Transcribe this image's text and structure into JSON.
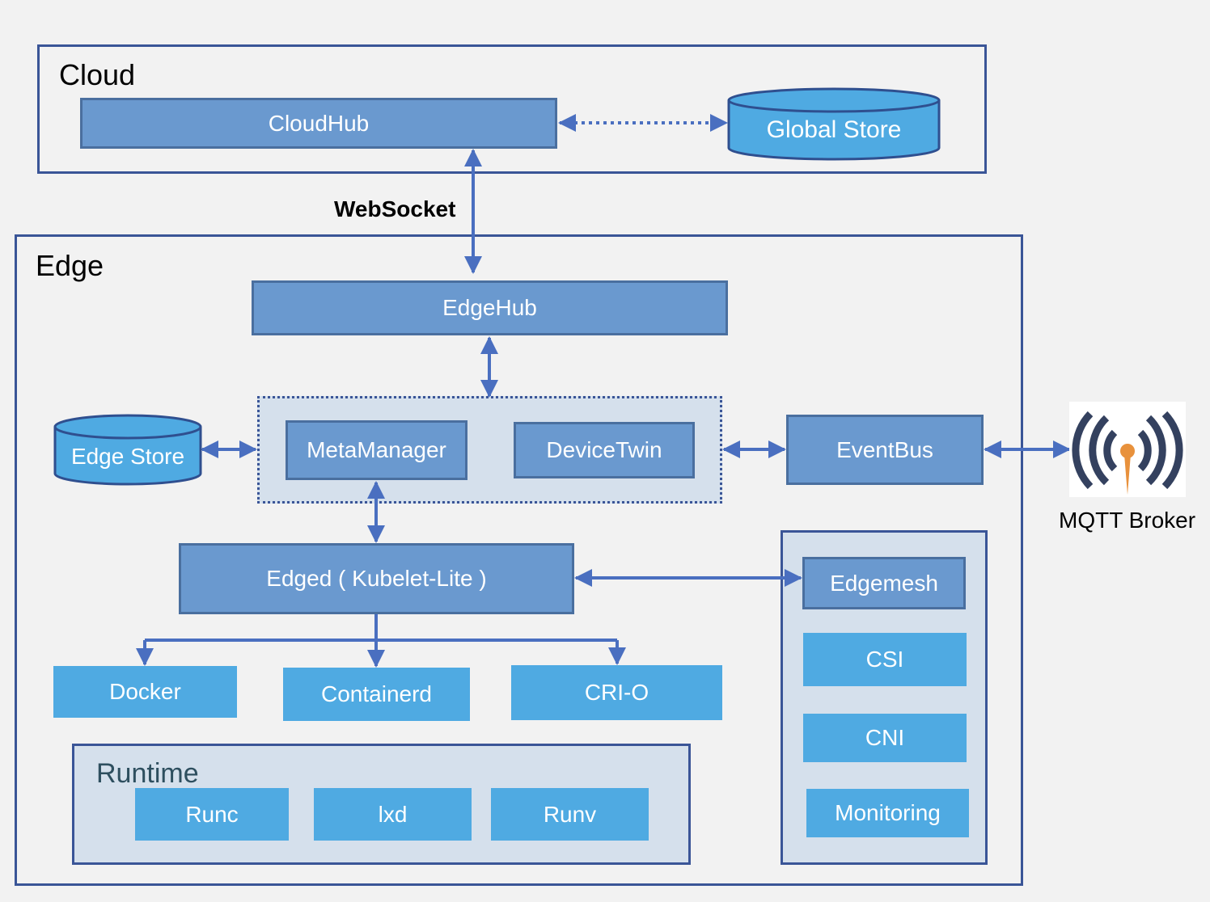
{
  "cloud": {
    "title": "Cloud",
    "cloudhub": "CloudHub",
    "global_store": "Global Store"
  },
  "link": {
    "websocket": "WebSocket"
  },
  "edge": {
    "title": "Edge",
    "edgehub": "EdgeHub",
    "edge_store": "Edge Store",
    "metamanager": "MetaManager",
    "devicetwin": "DeviceTwin",
    "eventbus": "EventBus",
    "edged": "Edged ( Kubelet-Lite )",
    "runtimes": [
      "Docker",
      "Containerd",
      "CRI-O"
    ],
    "runtime": {
      "title": "Runtime",
      "items": [
        "Runc",
        "lxd",
        "Runv"
      ]
    },
    "services": [
      "Edgemesh",
      "CSI",
      "CNI",
      "Monitoring"
    ]
  },
  "mqtt": {
    "label": "MQTT Broker",
    "icon": "mqtt-broadcast-icon"
  },
  "colors": {
    "module": "#6a99cf",
    "runtime": "#4faae2",
    "group": "#d5e0ec",
    "frame": "#3a5597",
    "arrow": "#4a6fc0",
    "mqtt_dark": "#34415f",
    "mqtt_accent": "#e8913c"
  }
}
